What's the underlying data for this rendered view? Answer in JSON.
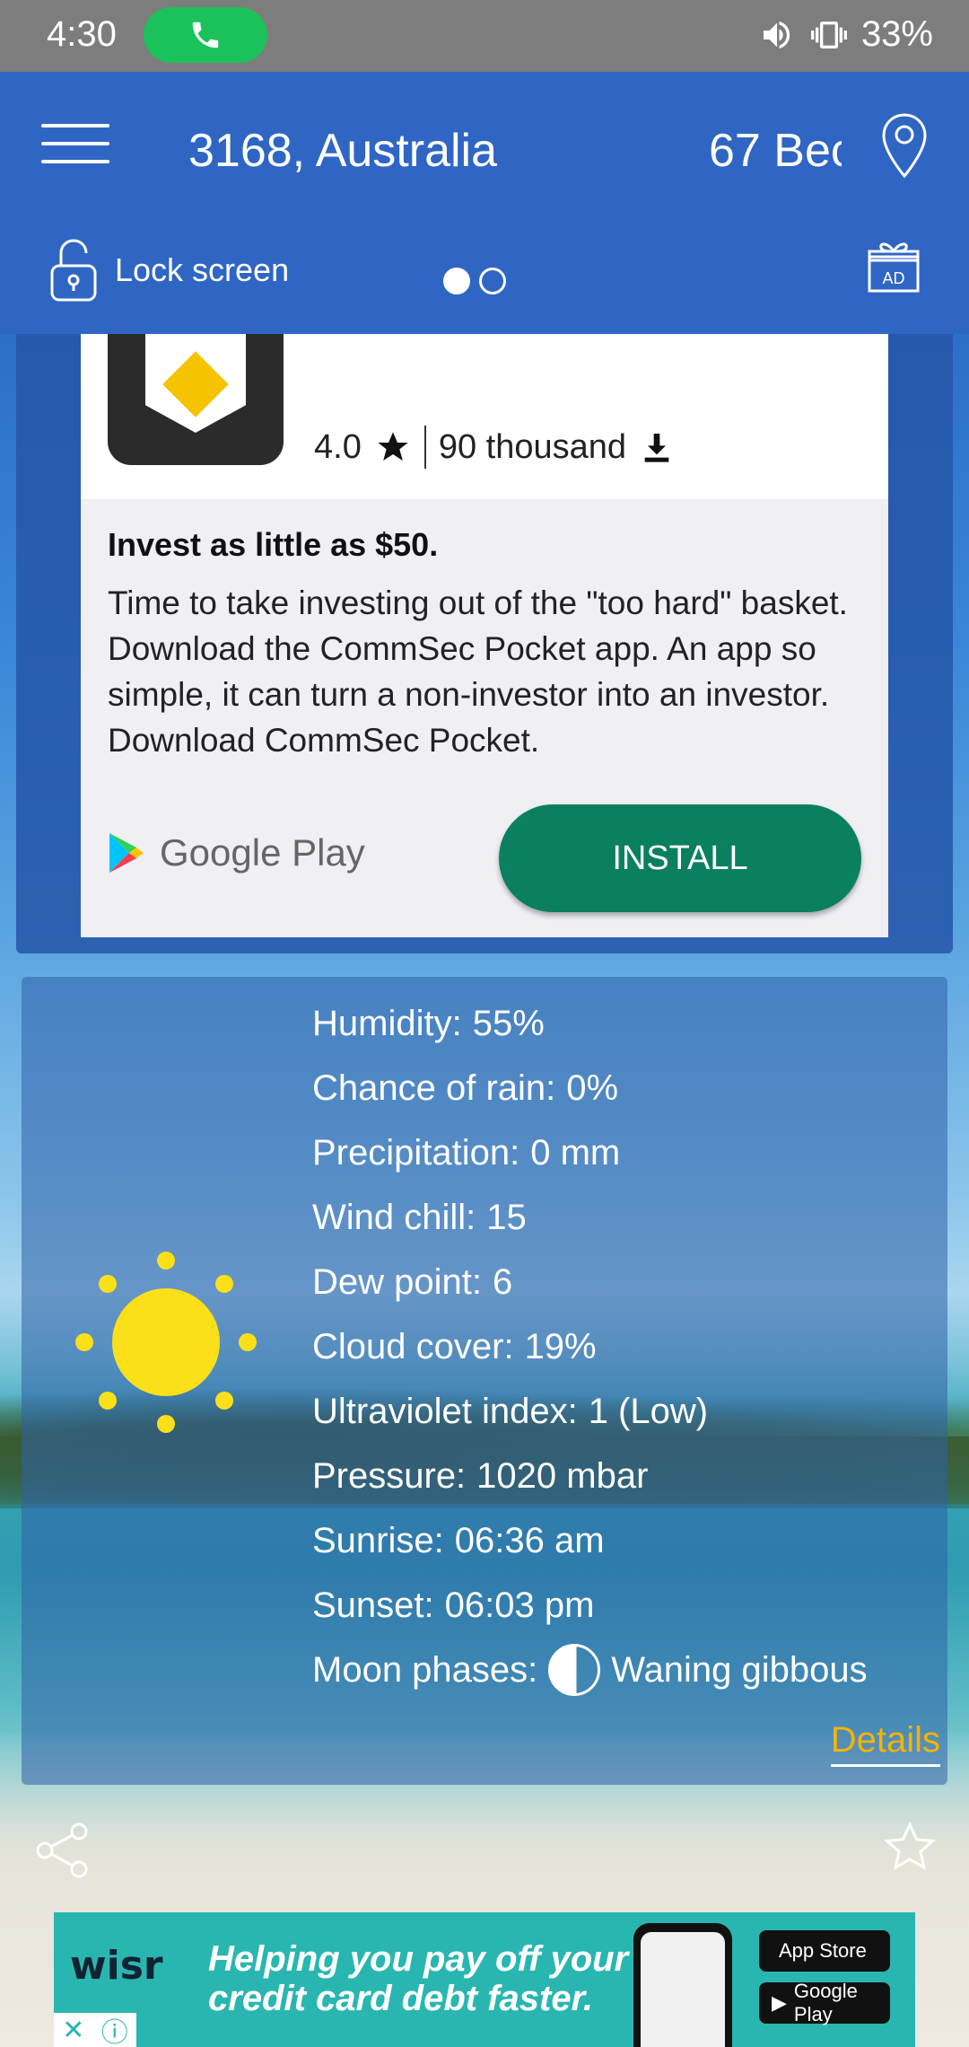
{
  "status_bar": {
    "time": "4:30",
    "battery": "33%"
  },
  "header": {
    "location_primary": "3168, Australia",
    "location_secondary": "67 Bec",
    "lock_label": "Lock screen",
    "ad_badge": "AD"
  },
  "ad": {
    "rating": "4.0",
    "downloads": "90 thousand",
    "headline": "Invest as little as $50.",
    "body": "Time to take investing out of the \"too hard\" basket. Download the CommSec Pocket app. An app so simple, it can turn a non-investor into an investor. Download CommSec Pocket.",
    "store_name": "Google Play",
    "install_label": "INSTALL"
  },
  "weather_details": {
    "rows": [
      {
        "label": "Humidity:",
        "value": "55%"
      },
      {
        "label": "Chance of rain:",
        "value": "0%"
      },
      {
        "label": "Precipitation:",
        "value": "0 mm"
      },
      {
        "label": "Wind chill:",
        "value": "15"
      },
      {
        "label": "Dew point:",
        "value": "6"
      },
      {
        "label": "Cloud cover:",
        "value": "19%"
      },
      {
        "label": "Ultraviolet index:",
        "value": "1 (Low)"
      },
      {
        "label": "Pressure:",
        "value": "1020 mbar"
      },
      {
        "label": "Sunrise:",
        "value": "06:36 am"
      },
      {
        "label": "Sunset:",
        "value": "06:03 pm"
      },
      {
        "label": "Moon phases:",
        "value": "Waning gibbous"
      }
    ],
    "details_link": "Details"
  },
  "banner": {
    "brand": "wisr",
    "tagline_1": "Helping you pay off your",
    "tagline_2": "credit card debt faster.",
    "store_1": "App Store",
    "store_2": "Google Play"
  }
}
